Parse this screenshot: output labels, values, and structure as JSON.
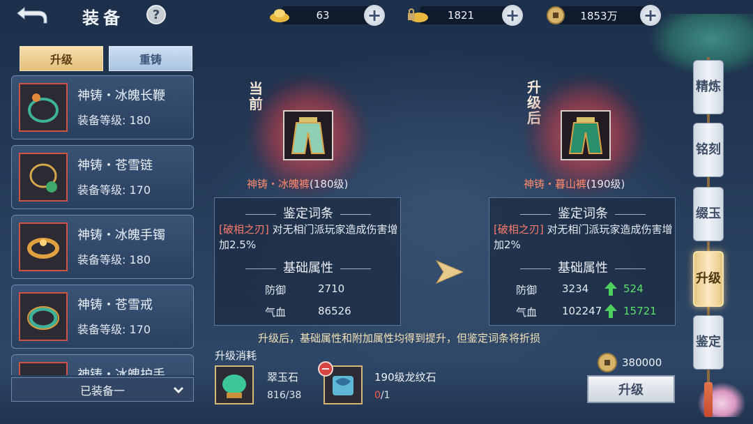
{
  "header": {
    "title": "装备",
    "help": "?"
  },
  "currencies": [
    {
      "name": "gold-ingot",
      "icon": "gold-ingot-icon",
      "value": "63"
    },
    {
      "name": "locked-ingot",
      "icon": "locked-ingot-icon",
      "value": "1821"
    },
    {
      "name": "copper-coin",
      "icon": "coin-icon",
      "value": "1853万"
    }
  ],
  "tabs": {
    "upgrade": "升级",
    "recast": "重铸"
  },
  "equipment_list": [
    {
      "name": "神铸・冰魄长鞭",
      "level": "装备等级: 180",
      "icon": "whip-icon"
    },
    {
      "name": "神铸・苍雪链",
      "level": "装备等级: 170",
      "icon": "necklace-icon"
    },
    {
      "name": "神铸・冰魄手镯",
      "level": "装备等级: 180",
      "icon": "bracelet-icon"
    },
    {
      "name": "神铸・苍雪戒",
      "level": "装备等级: 170",
      "icon": "ring-icon"
    },
    {
      "name": "神铸・冰魄护手",
      "level": "",
      "icon": "gauntlet-icon"
    }
  ],
  "equipped_filter": "已装备一",
  "current": {
    "label": "当前",
    "prefix": "神铸・冰魄裤",
    "level": "(180级)",
    "identify_header": "鉴定词条",
    "identify_tag": "[破相之刃]",
    "identify_text": "对无相门派玩家造成伤害增加2.5%",
    "base_header": "基础属性",
    "stats": [
      {
        "label": "防御",
        "value": "2710"
      },
      {
        "label": "气血",
        "value": "86526"
      }
    ]
  },
  "upgraded": {
    "label": "升级后",
    "prefix": "神铸・暮山裤",
    "level": "(190级)",
    "identify_header": "鉴定词条",
    "identify_tag": "[破相之刃]",
    "identify_text": "对无相门派玩家造成伤害增加2%",
    "base_header": "基础属性",
    "stats": [
      {
        "label": "防御",
        "value": "3234",
        "gain": "524"
      },
      {
        "label": "气血",
        "value": "102247",
        "gain": "15721"
      }
    ]
  },
  "notice": "升级后，基础属性和附加属性均得到提升，但鉴定词条将折损",
  "cost": {
    "title": "升级消耗",
    "materials": [
      {
        "name": "翠玉石",
        "have": "816",
        "need": "/38",
        "icon": "jade-stone-icon"
      },
      {
        "name": "190级龙纹石",
        "have": "0",
        "need": "/1",
        "icon": "dragon-stone-icon"
      }
    ],
    "silver": "380000"
  },
  "upgrade_button": "升级",
  "side_tabs": [
    {
      "label": "精炼",
      "active": false
    },
    {
      "label": "铭刻",
      "active": false
    },
    {
      "label": "缀玉",
      "active": false
    },
    {
      "label": "升级",
      "active": true
    },
    {
      "label": "鉴定",
      "active": false
    }
  ]
}
